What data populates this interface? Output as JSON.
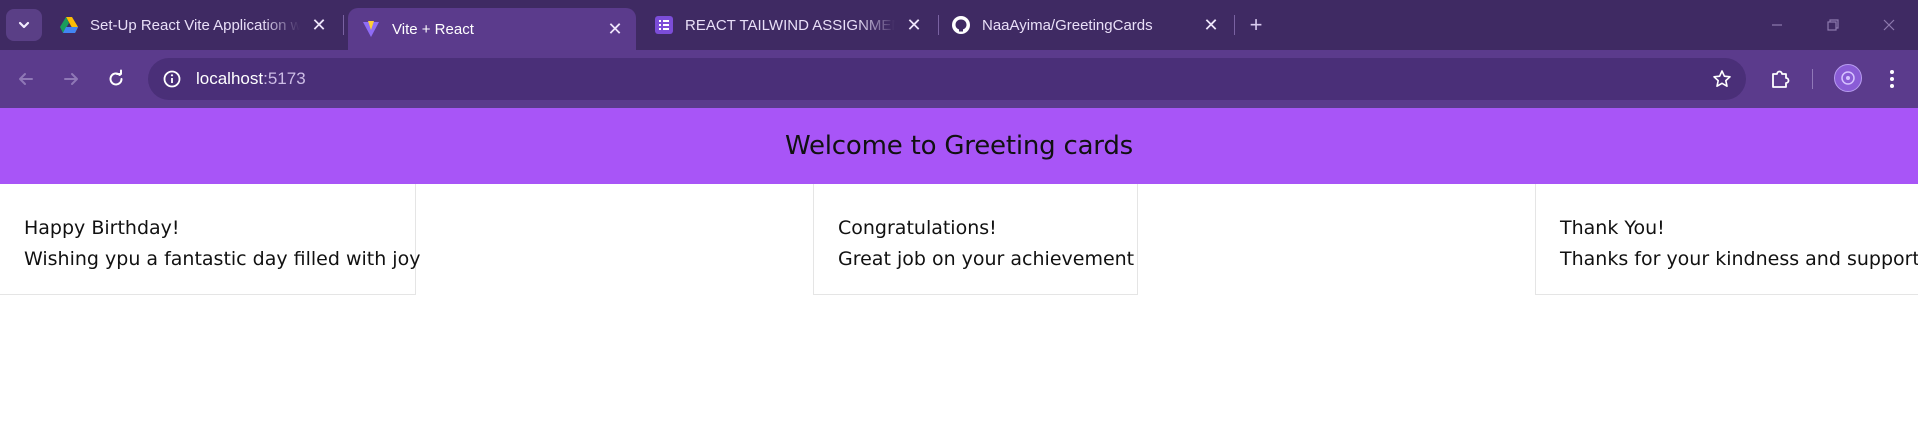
{
  "browser": {
    "tabs": [
      {
        "title": "Set-Up React Vite Application w",
        "favicon": "google-drive-icon",
        "active": false
      },
      {
        "title": "Vite + React",
        "favicon": "vite-icon",
        "active": true
      },
      {
        "title": "REACT TAILWIND ASSIGNMENT",
        "favicon": "google-forms-icon",
        "active": false
      },
      {
        "title": "NaaAyima/GreetingCards",
        "favicon": "github-icon",
        "active": false
      }
    ],
    "close_glyph": "✕",
    "new_tab_glyph": "+",
    "url_host": "localhost",
    "url_port": ":5173"
  },
  "page": {
    "heading": "Welcome to Greeting cards",
    "cards": [
      {
        "title": "Happy Birthday!",
        "message": "Wishing ypu a fantastic day filled with joy"
      },
      {
        "title": "Congratulations!",
        "message": "Great job on your achievement"
      },
      {
        "title": "Thank You!",
        "message": "Thanks for your kindness and support"
      }
    ]
  },
  "colors": {
    "tabstrip": "#3f2a63",
    "toolbar": "#5b3b8c",
    "omnibox": "#4a2f78",
    "banner": "#a855f7"
  }
}
